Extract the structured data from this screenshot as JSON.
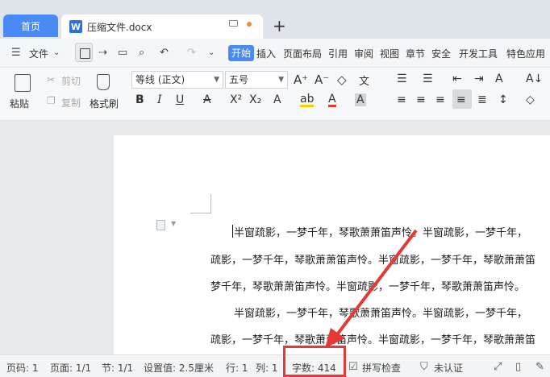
{
  "tabs": {
    "home": "首页",
    "doc_logo": "W",
    "doc_title": "压缩文件.docx",
    "add": "+"
  },
  "menu": {
    "file": "文件",
    "items": [
      "开始",
      "插入",
      "页面布局",
      "引用",
      "审阅",
      "视图",
      "章节",
      "安全",
      "开发工具",
      "特色应用"
    ]
  },
  "ribbon": {
    "paste": "粘贴",
    "cut": "剪切",
    "copy": "复制",
    "format_painter": "格式刷",
    "font_name": "等线 (正文)",
    "font_size": "五号"
  },
  "document": {
    "lines": [
      "半窗疏影，一梦千年，琴歌萧萧笛声怜。半窗疏影，一梦千年，",
      "疏影，一梦千年，琴歌萧萧笛声怜。半窗疏影，一梦千年，琴歌萧萧笛",
      "梦千年，琴歌萧萧笛声怜。半窗疏影，一梦千年，琴歌萧萧笛声怜。",
      "半窗疏影，一梦千年，琴歌萧萧笛声怜。半窗疏影，一梦千年，",
      "疏影，一梦千年，琴歌萧萧笛声怜。半窗疏影，一梦千年，琴歌萧萧笛"
    ]
  },
  "status": {
    "page_num": "页码: 1",
    "pages": "页面: 1/1",
    "section": "节: 1/1",
    "setting": "设置值: 2.5厘米",
    "row": "行: 1",
    "col": "列: 1",
    "word_count": "字数: 414",
    "spell_check": "拼写检查",
    "certify": "未认证"
  },
  "colors": {
    "accent": "#4a8af4",
    "highlight": "#e53935"
  }
}
